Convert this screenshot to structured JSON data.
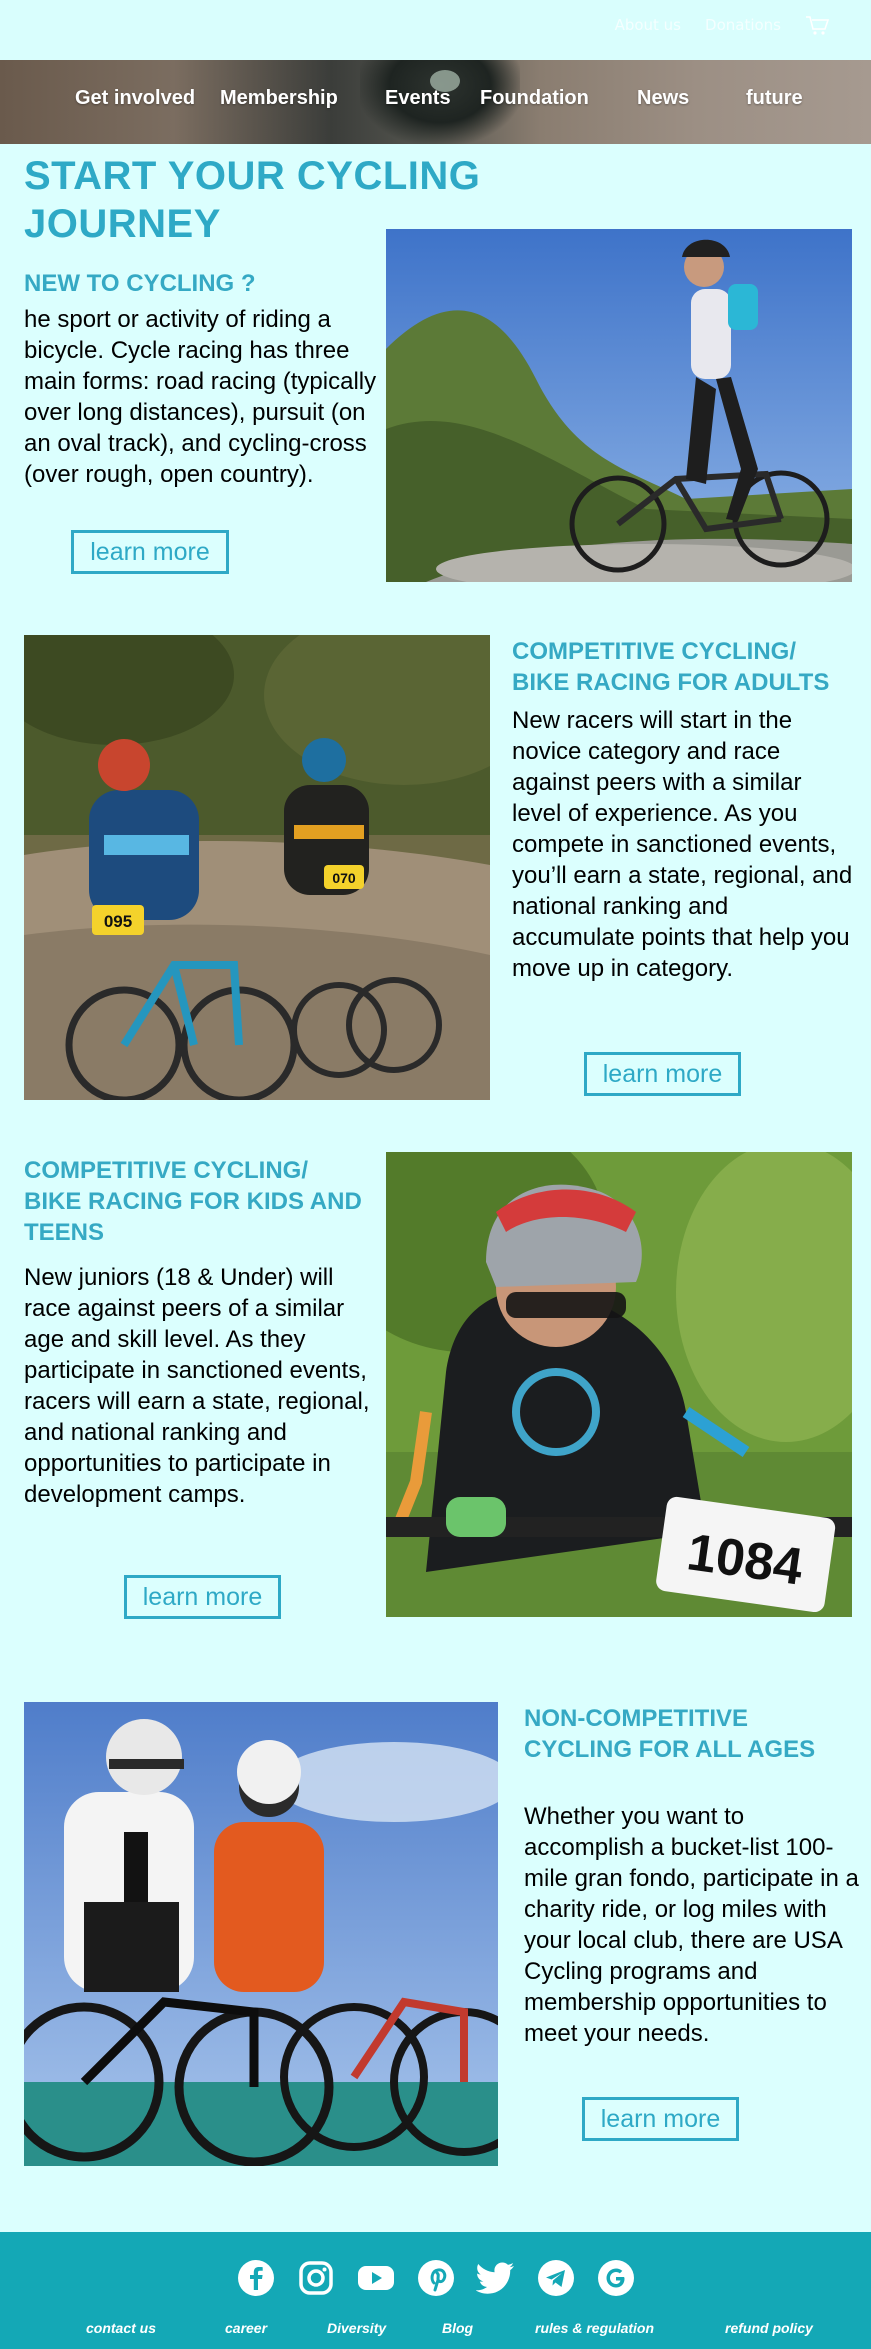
{
  "topbar": {
    "about_label": "About us",
    "donate_label": "Donations"
  },
  "nav": {
    "items": [
      "Get involved",
      "Membership",
      "Events",
      "Foundation",
      "News",
      "future"
    ]
  },
  "hero": {
    "title": "START YOUR CYCLING JOURNEY"
  },
  "sections": [
    {
      "heading": "NEW TO CYCLING ?",
      "text": "he sport or activity of riding a bicycle. Cycle racing has three main forms: road racing (typically over long distances), pursuit (on an oval track), and cycling-cross (over rough, open country).",
      "button": "learn more"
    },
    {
      "heading": "COMPETITIVE CYCLING/ BIKE RACING FOR ADULTS",
      "text": "New racers will start in the novice category and race against peers with a similar level of experience. As you compete in sanctioned events, you’ll earn a state, regional, and national ranking and accumulate points that help you move up in category.",
      "button": "learn more",
      "bib_numbers": [
        "095",
        "070"
      ]
    },
    {
      "heading": "COMPETITIVE CYCLING/ BIKE RACING FOR KIDS AND TEENS",
      "text": "New juniors (18 & Under) will race against peers of a similar age and skill level. As they participate in sanctioned events, racers will earn a state, regional, and national ranking and opportunities to participate in development camps.",
      "button": "learn more",
      "bib_number": "1084"
    },
    {
      "heading": "NON-COMPETITIVE CYCLING FOR ALL AGES",
      "text": "Whether you want to accomplish a bucket-list 100-mile gran fondo, participate in a charity ride, or log miles with your local club, there are USA Cycling programs and membership opportunities to meet your needs.",
      "button": "learn more"
    }
  ],
  "footer": {
    "social_icons": [
      "facebook-icon",
      "instagram-icon",
      "youtube-icon",
      "pinterest-icon",
      "twitter-icon",
      "telegram-icon",
      "google-icon"
    ],
    "links": [
      "contact us",
      "career",
      "Diversity",
      "Blog",
      "rules & regulation",
      "refund policy"
    ]
  },
  "colors": {
    "background": "#dbfffe",
    "accent": "#2ea9c6",
    "footer": "#14a8b6"
  }
}
